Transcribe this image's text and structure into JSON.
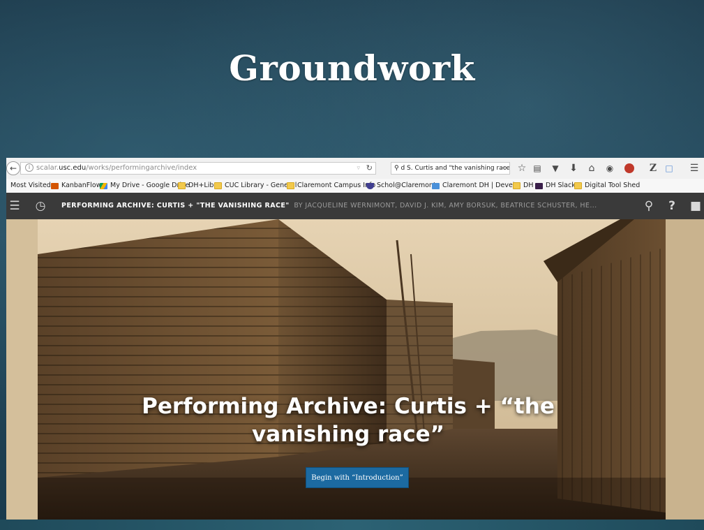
{
  "slide": {
    "title": "Groundwork"
  },
  "browser": {
    "url_prefix": "scalar.",
    "url_host": "usc.edu",
    "url_path": "/works/performingarchive/index",
    "search_value": "d S. Curtis and \"the vanishing race\"",
    "toolbar_icons": [
      "star-icon",
      "clipboard-icon",
      "pocket-icon",
      "download-icon",
      "home-icon",
      "chat-icon",
      "adblock-icon",
      "zotero-icon",
      "page-icon",
      "menu-icon"
    ]
  },
  "bookmarks": [
    {
      "label": "Most Visited",
      "icon": "gear"
    },
    {
      "label": "KanbanFlow",
      "icon": "kanban"
    },
    {
      "label": "My Drive - Google Drive",
      "icon": "drive"
    },
    {
      "label": "DH+Lib",
      "icon": "folder"
    },
    {
      "label": "CUC Library - General",
      "icon": "folder"
    },
    {
      "label": "Claremont Campus Info",
      "icon": "folder"
    },
    {
      "label": "Schol@Claremont",
      "icon": "shield"
    },
    {
      "label": "Claremont DH | Devel...",
      "icon": "scholar"
    },
    {
      "label": "DH",
      "icon": "folder"
    },
    {
      "label": "DH Slack",
      "icon": "dhslack"
    },
    {
      "label": "Digital Tool Shed",
      "icon": "folder"
    }
  ],
  "scalar": {
    "title": "PERFORMING ARCHIVE: CURTIS + \"THE VANISHING RACE\"",
    "authors": "BY JACQUELINE WERNIMONT, DAVID J. KIM, AMY BORSUK, BEATRICE SCHUSTER, HE...",
    "hero_title": "Performing Archive: Curtis + “the vanishing race”",
    "begin_button": "Begin with “Introduction”"
  },
  "colors": {
    "nav_bg": "#3a3a3a",
    "button_bg": "#1c6aa1",
    "slide_bg": "#1d3a4c"
  }
}
